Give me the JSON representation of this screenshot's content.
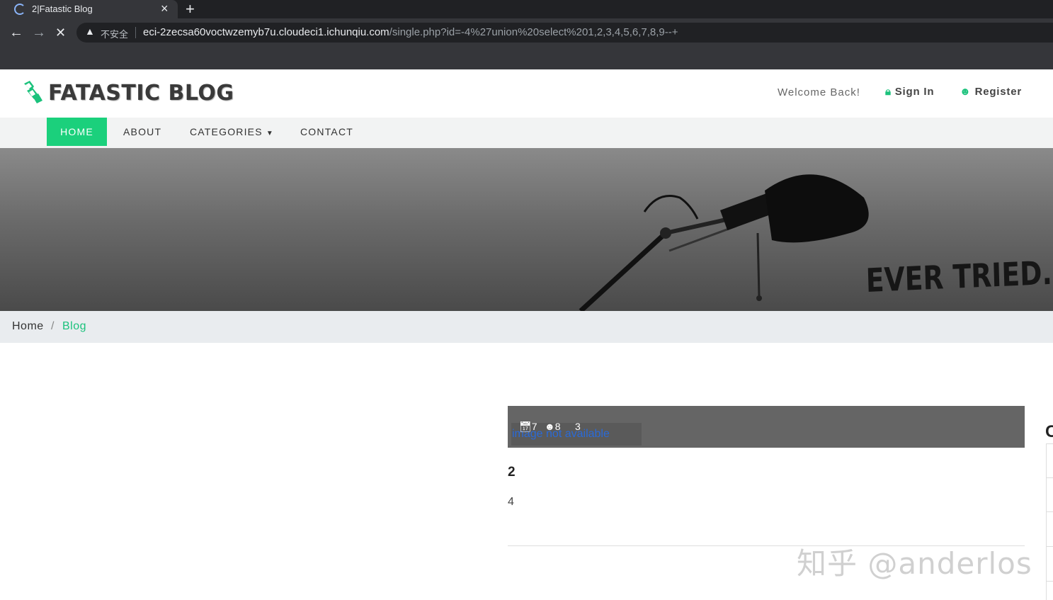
{
  "browser": {
    "tab_title": "2|Fatastic Blog",
    "tab_close": "×",
    "new_tab": "+",
    "back": "←",
    "forward": "→",
    "stop": "✕",
    "warning_icon": "▲",
    "insecure_label": "不安全",
    "url_host": "eci-2zecsa60voctwzemyb7u.cloudeci1.ichunqiu.com",
    "url_path": "/single.php?id=-4%27union%20select%201,2,3,4,5,6,7,8,9--+"
  },
  "header": {
    "logo_text": "FATASTIC BLOG",
    "welcome": "Welcome Back!",
    "sign_in": "Sign In",
    "register": "Register"
  },
  "nav": {
    "home": "HOME",
    "about": "ABOUT",
    "categories": "CATEGORIES",
    "contact": "CONTACT"
  },
  "hero": {
    "text": "EVER TRIED."
  },
  "breadcrumb": {
    "home": "Home",
    "separator": "/",
    "current": "Blog"
  },
  "post": {
    "image_alt": "image not available",
    "date": "7",
    "author": "8",
    "comments": "3",
    "title": "2",
    "body": "4"
  },
  "sidebar": {
    "heading_fragment": "C"
  },
  "watermark": "知乎 @anderlos",
  "colors": {
    "accent": "#1bd07c",
    "link": "#1bc27c"
  }
}
